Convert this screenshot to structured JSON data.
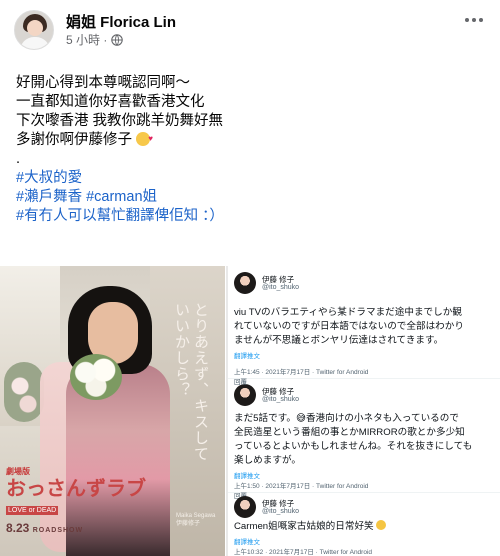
{
  "post": {
    "author": "娟姐 Florica Lin",
    "time": "5 小時 ·",
    "privacy_icon": "globe-icon",
    "lines": [
      "好開心得到本尊嘅認同啊～",
      "一直都知道你好喜歡香港文化",
      "下次嚟香港 我教你跳羊奶舞好無",
      "多謝你啊伊藤修子",
      "."
    ],
    "hashtags": [
      "#大叔的愛",
      "#瀨戶舞香 #carman姐",
      "#有冇人可以幫忙翻譯俾佢知 ：）"
    ]
  },
  "poster": {
    "vertical_text": "とりあえず、キスしていいかしら？",
    "logo_small": "劇場版",
    "logo": "おっさんずラブ",
    "logo_sub": "LOVE or DEAD",
    "date": "8.23",
    "date_sub": "ROADSHOW",
    "credit": "Maika Segawa 伊藤修子"
  },
  "tweets": [
    {
      "name": "伊藤 修子",
      "handle": "@ito_shuko",
      "body": [
        "viu TVのバラエティやら某ドラマまだ途中までしか観",
        "れていないのですが日本語ではないので全部はわかり",
        "ませんが不思議とボンヤリ伝達はされてきます。"
      ],
      "translate": "翻譯推文",
      "time": "上午1:45 · 2021年7月17日 · Twitter for Android"
    },
    {
      "name": "伊藤 修子",
      "handle": "@ito_shuko",
      "reply_label": "回覆",
      "body": [
        "まだ5話です。😅香港向けの小ネタも入っているので",
        "全民造星という番組の事とかMIRRORの歌とか多少知",
        "っているとよいかもしれませんね。それを抜きにしても",
        "楽しめますが。"
      ],
      "translate": "翻譯推文",
      "time": "上午1:50 · 2021年7月17日 · Twitter for Android"
    },
    {
      "name": "伊藤 修子",
      "handle": "@ito_shuko",
      "reply_label": "回覆",
      "body": [
        "Carmen姐嘅家古姑娘的日常好笑"
      ],
      "translate": "翻譯推文",
      "time": "上午10:32 · 2021年7月17日 · Twitter for Android"
    }
  ]
}
